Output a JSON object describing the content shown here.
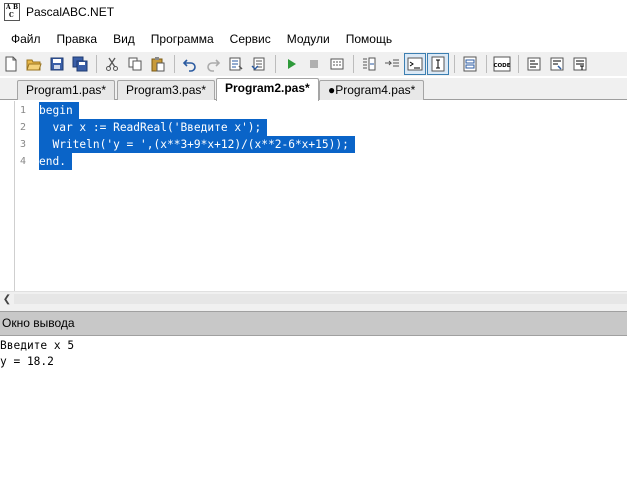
{
  "window": {
    "title": "PascalABC.NET",
    "icon_letters": [
      "A",
      "B",
      "C"
    ]
  },
  "menu": {
    "items": [
      "Файл",
      "Правка",
      "Вид",
      "Программа",
      "Сервис",
      "Модули",
      "Помощь"
    ]
  },
  "toolbar": {
    "buttons": [
      {
        "name": "new-icon"
      },
      {
        "name": "open-icon"
      },
      {
        "name": "save-icon"
      },
      {
        "name": "save-all-icon"
      },
      {
        "name": "cut-icon"
      },
      {
        "name": "copy-icon"
      },
      {
        "name": "paste-icon"
      },
      {
        "name": "undo-icon"
      },
      {
        "name": "redo-icon"
      },
      {
        "name": "format-icon"
      },
      {
        "name": "compile-icon"
      },
      {
        "name": "run-icon"
      },
      {
        "name": "stop-icon"
      },
      {
        "name": "debug-icon"
      },
      {
        "name": "step-into-icon"
      },
      {
        "name": "step-over-icon"
      },
      {
        "name": "console-icon"
      },
      {
        "name": "text-cursor-icon"
      },
      {
        "name": "form-icon"
      },
      {
        "name": "code-icon"
      },
      {
        "name": "io-icon"
      },
      {
        "name": "io-watch-icon"
      },
      {
        "name": "io-run-icon"
      }
    ],
    "code_label": "CODE"
  },
  "tabs": [
    {
      "label": "Program1.pas*",
      "active": false
    },
    {
      "label": "Program3.pas*",
      "active": false
    },
    {
      "label": "Program2.pas*",
      "active": true
    },
    {
      "label": "●Program4.pas*",
      "active": false
    }
  ],
  "editor": {
    "line_numbers": [
      "1",
      "2",
      "3",
      "4"
    ],
    "lines": [
      "begin",
      "  var x := ReadReal('Введите x');",
      "  Writeln('y = ',(x**3+9*x+12)/(x**2-6*x+15));",
      "end."
    ],
    "selection_color": "#0a64c8"
  },
  "output": {
    "title": "Окно вывода",
    "lines": [
      "Введите x 5",
      "y = 18.2"
    ]
  }
}
